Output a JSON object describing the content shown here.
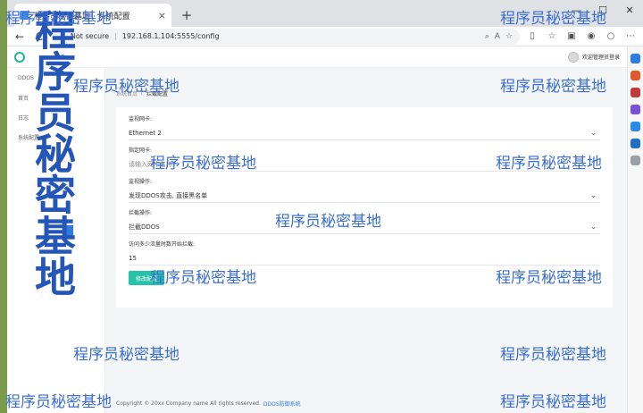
{
  "browser": {
    "tab_title": "程序员秘密基地 · 系统配置",
    "new_tab": "+",
    "close_tab": "×",
    "back": "←",
    "refresh": "C",
    "not_secure": "Not secure",
    "separator": "|",
    "url": "192.168.1.104:5555/config",
    "window_min": "—",
    "window_max": "☐",
    "window_close": "✕"
  },
  "app": {
    "header_link": "P",
    "user_label": "欢迎管理员登录"
  },
  "sidebar": {
    "items": [
      {
        "label": "DDOS"
      },
      {
        "label": "首页"
      },
      {
        "label": "日志"
      },
      {
        "label": "系统配置"
      }
    ]
  },
  "breadcrumb": {
    "home": "系统首页",
    "separator": "/",
    "current": "拦截配置"
  },
  "form": {
    "fields": [
      {
        "label": "监视网卡:",
        "value": "Ethernet 2",
        "type": "select"
      },
      {
        "label": "指定网卡:",
        "value": "请输入网卡名称",
        "type": "input-placeholder"
      },
      {
        "label": "监视操作:",
        "value": "发现DDOS攻击, 直接黑名单",
        "type": "select"
      },
      {
        "label": "拦截操作:",
        "value": "拦截DDOS",
        "type": "select"
      },
      {
        "label": "访问多少流量时数开始拦截:",
        "value": "15",
        "type": "input"
      }
    ],
    "submit_label": "修改配置"
  },
  "footer": {
    "text": "Copyright © 20xx Company name All rights reserved.",
    "link": "DDOS防御系统"
  },
  "watermark": {
    "text": "程序员秘密基地",
    "vertical": "程序员秘密基地"
  },
  "colors": {
    "accent": "#26c2a9",
    "link": "#2d7de0",
    "watermark": "#3a6fcf"
  }
}
